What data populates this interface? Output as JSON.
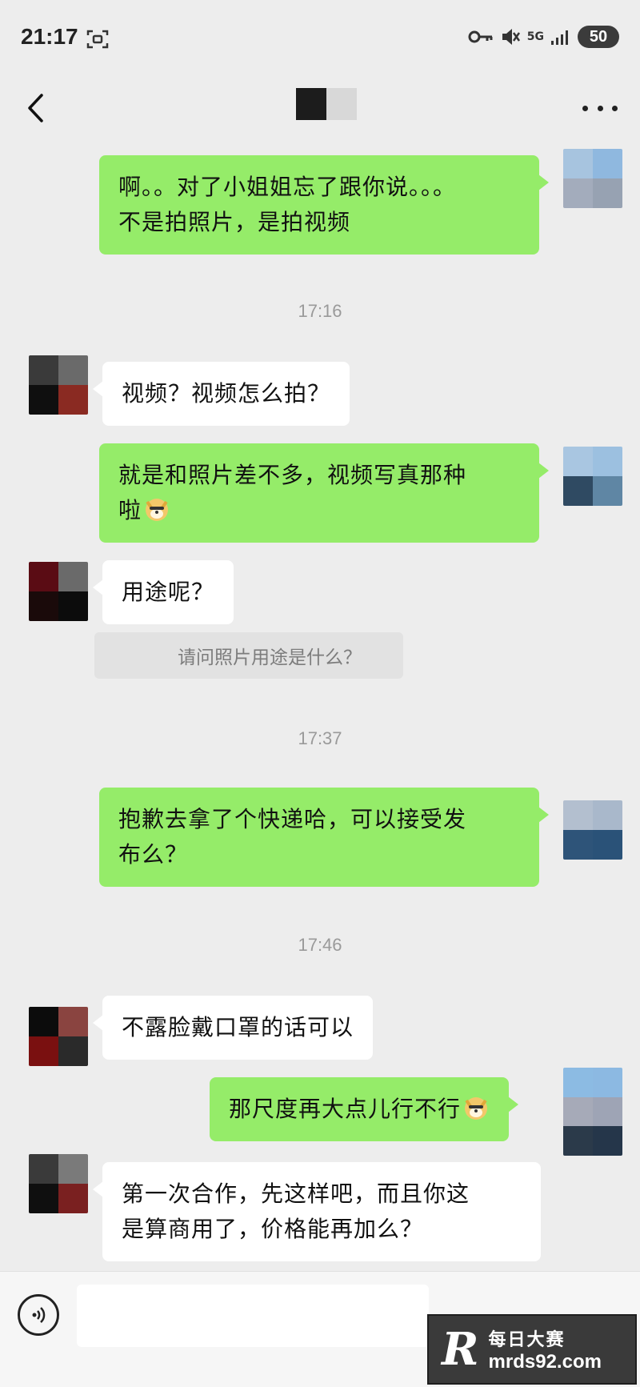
{
  "status_bar": {
    "time": "21:17",
    "network": "5G",
    "battery": "50"
  },
  "header": {
    "contact_name_blurred": true
  },
  "messages": [
    {
      "from": "me",
      "lines": [
        "啊。。对了小姐姐忘了跟你说。。。",
        "不是拍照片，是拍视频"
      ]
    },
    {
      "from": "other",
      "text": "视频？视频怎么拍？"
    },
    {
      "from": "me",
      "lines": [
        "就是和照片差不多，视频写真那种",
        "啦"
      ],
      "emoji": "doge-icon"
    },
    {
      "from": "other",
      "text": "用途呢？"
    },
    {
      "from": "me",
      "lines": [
        "抱歉去拿了个快递哈，可以接受发",
        "布么？"
      ]
    },
    {
      "from": "other",
      "text": "不露脸戴口罩的话可以"
    },
    {
      "from": "me",
      "text": "那尺度再大点儿行不行",
      "emoji": "doge-icon"
    },
    {
      "from": "other",
      "lines": [
        "第一次合作，先这样吧，而且你这",
        "是算商用了，价格能再加么？"
      ]
    }
  ],
  "quote": {
    "text": "请问照片用途是什么？"
  },
  "timestamps": [
    "17:16",
    "17:37",
    "17:46"
  ],
  "watermark": {
    "logo": "R",
    "name_cn": "每日大赛",
    "url": "mrds92.com"
  },
  "colors": {
    "my_bubble": "#95ec69",
    "other_bubble": "#ffffff",
    "background": "#ededed"
  }
}
